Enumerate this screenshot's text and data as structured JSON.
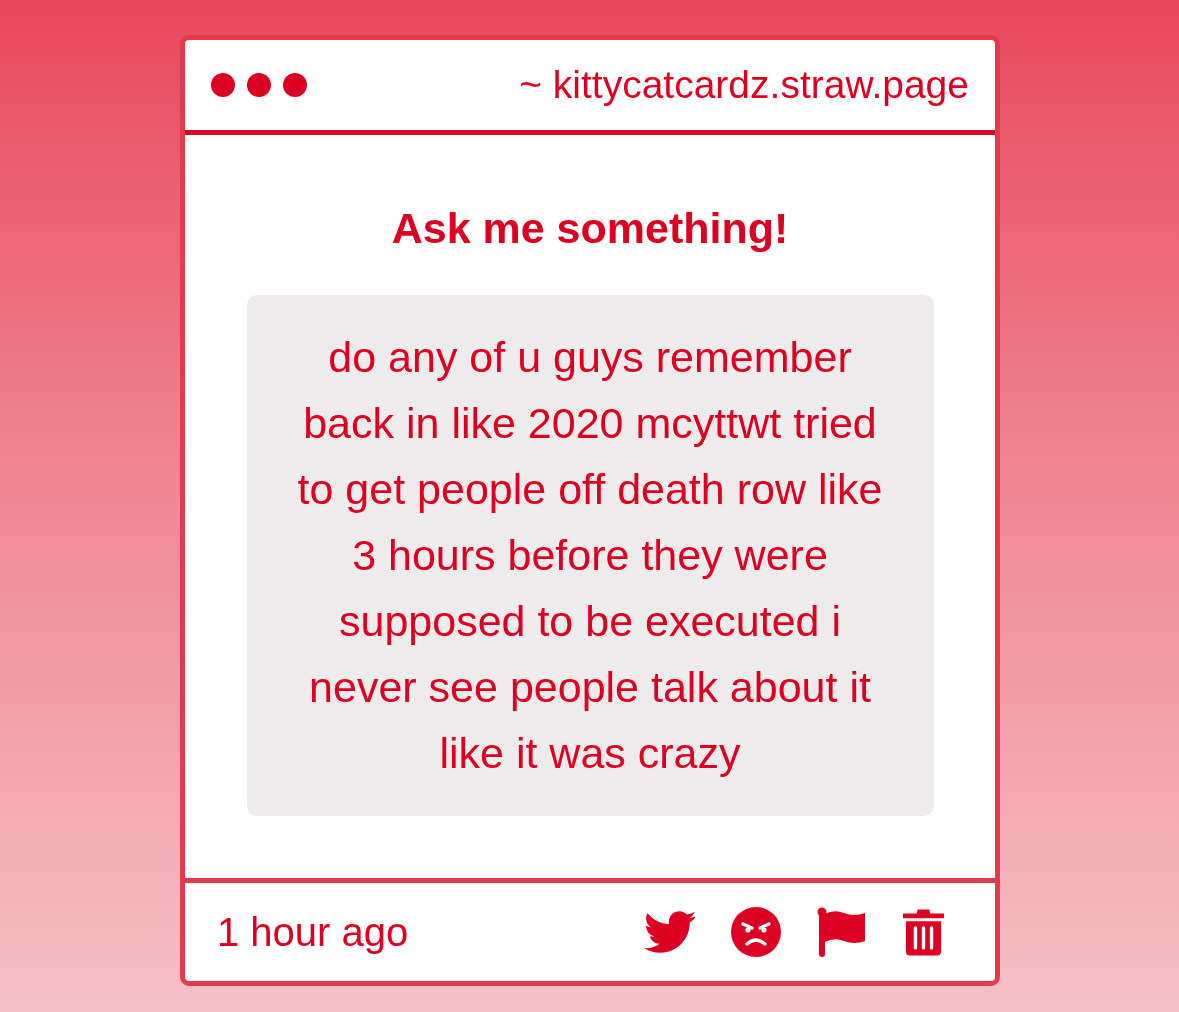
{
  "window": {
    "address": "~ kittycatcardz.straw.page"
  },
  "title": "Ask me something!",
  "question": {
    "text": "do any of u guys remember back in like 2020 mcyttwt tried to get people off death row like 3 hours before they were supposed to be executed i never see people talk about it like it was crazy"
  },
  "footer": {
    "time": "1 hour ago"
  }
}
